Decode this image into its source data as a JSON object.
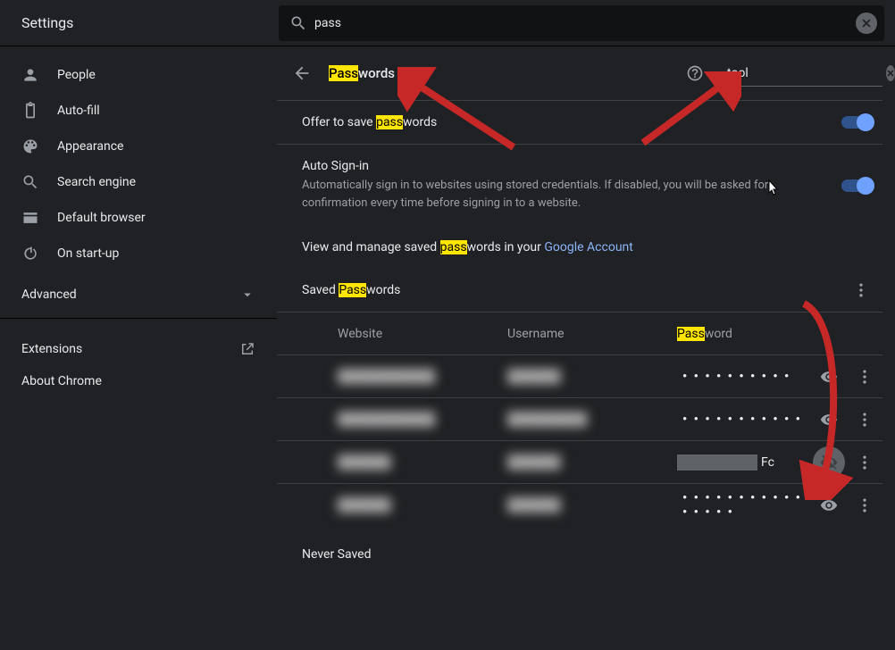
{
  "app_title": "Settings",
  "top_search": {
    "value": "pass"
  },
  "sidebar": {
    "items": [
      {
        "label": "People"
      },
      {
        "label": "Auto-fill"
      },
      {
        "label": "Appearance"
      },
      {
        "label": "Search engine"
      },
      {
        "label": "Default browser"
      },
      {
        "label": "On start-up"
      }
    ],
    "advanced": "Advanced",
    "extensions": "Extensions",
    "about": "About Chrome"
  },
  "page": {
    "title_pre": "Pass",
    "title_post": "words",
    "filter_value": "tool"
  },
  "settings": {
    "offer_pre": "Offer to save ",
    "offer_hl": "pass",
    "offer_post": "words",
    "auto_title": "Auto Sign-in",
    "auto_desc": "Automatically sign in to websites using stored credentials. If disabled, you will be asked for confirmation every time before signing in to a website.",
    "viewmanage_pre": "View and manage saved ",
    "viewmanage_hl": "pass",
    "viewmanage_mid": "words in your ",
    "viewmanage_link": "Google Account"
  },
  "saved": {
    "header_pre": "Saved ",
    "header_hl": "Pass",
    "header_post": "words",
    "col_website": "Website",
    "col_username": "Username",
    "col_password_pre": "Pass",
    "col_password_post": "word",
    "rows": [
      {
        "website": "███████████",
        "username": "██████",
        "password_masked": "• • • • • • • • • •",
        "revealed": false
      },
      {
        "website": "███████████",
        "username": "█████████",
        "password_masked": "• • • • • • • • • • •",
        "revealed": false
      },
      {
        "website": "██████",
        "username": "██████",
        "password_revealed_suffix": "Fc",
        "revealed": true
      },
      {
        "website": "██████",
        "username": "██████",
        "password_masked": "• • • • • • • • • • • • • • • •",
        "revealed": false
      }
    ]
  },
  "never_saved": "Never Saved"
}
